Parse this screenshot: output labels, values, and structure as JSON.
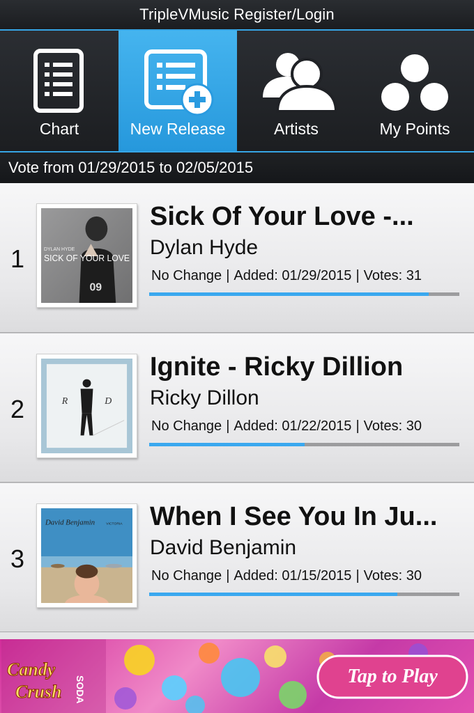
{
  "header": {
    "title": "TripleVMusic Register/Login"
  },
  "tabs": [
    {
      "label": "Chart",
      "icon": "list-icon",
      "active": false
    },
    {
      "label": "New Release",
      "icon": "add-list-icon",
      "active": true
    },
    {
      "label": "Artists",
      "icon": "people-icon",
      "active": false
    },
    {
      "label": "My Points",
      "icon": "points-icon",
      "active": false
    }
  ],
  "vote_period": "Vote from 01/29/2015 to 02/05/2015",
  "songs": [
    {
      "rank": "1",
      "title": "Sick Of Your Love -...",
      "artist": "Dylan Hyde",
      "change": "No Change",
      "added": "Added: 01/29/2015",
      "votes": "Votes: 31",
      "progress": 0.9,
      "cover_text": "SICK OF YOUR LOVE",
      "cover_small": "DYLAN HYDE",
      "cover_shirt": "09"
    },
    {
      "rank": "2",
      "title": "Ignite - Ricky Dillion",
      "artist": "Ricky Dillon",
      "change": "No Change",
      "added": "Added: 01/22/2015",
      "votes": "Votes: 30",
      "progress": 0.5,
      "cover_letters": [
        "R",
        "D"
      ]
    },
    {
      "rank": "3",
      "title": "When I See You In Ju...",
      "artist": "David Benjamin",
      "change": "No Change",
      "added": "Added: 01/15/2015",
      "votes": "Votes: 30",
      "progress": 0.8,
      "cover_text": "David Benjamin",
      "cover_small": "VICTORIA"
    }
  ],
  "ad": {
    "logo": "Candy Crush SODA",
    "cta": "Tap to Play"
  },
  "colors": {
    "accent": "#37a6e6",
    "progress": "#3aa8ef",
    "track": "#9c9c9e"
  }
}
